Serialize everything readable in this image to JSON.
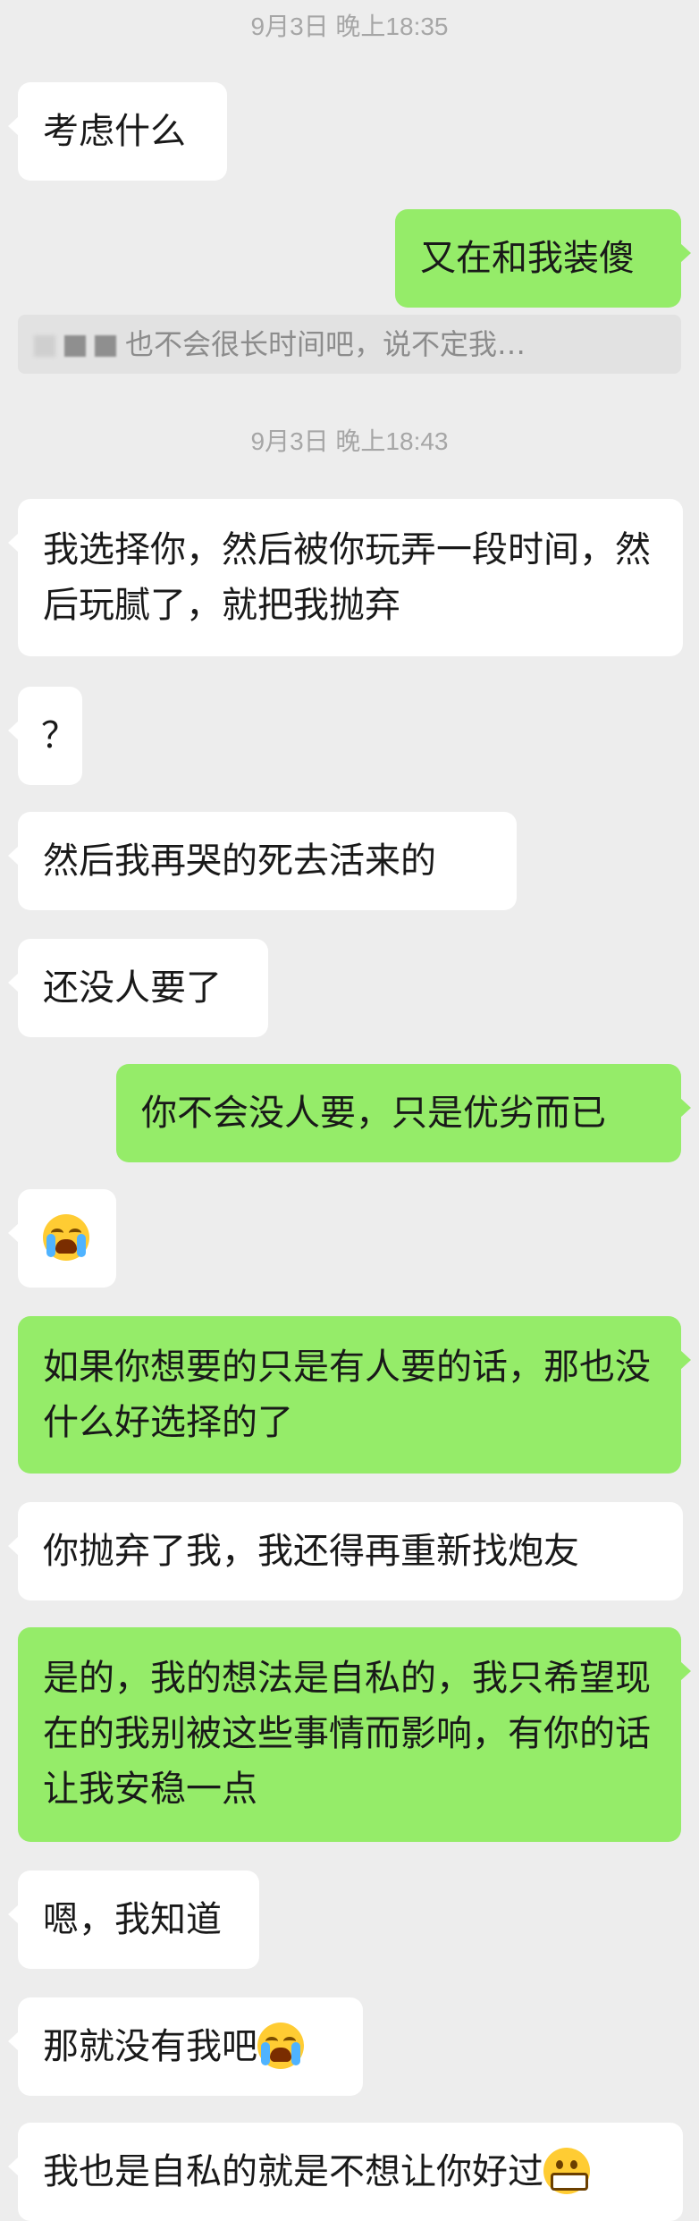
{
  "timestamps": [
    "9月3日 晚上18:35",
    "9月3日 晚上18:43"
  ],
  "quote": {
    "text": "也不会很长时间吧，说不定我…"
  },
  "messages": {
    "m1": "考虑什么",
    "m2": "又在和我装傻",
    "m3": "我选择你，然后被你玩弄一段时间，然后玩腻了，就把我抛弃",
    "m4": "？",
    "m5": "然后我再哭的死去活来的",
    "m6": "还没人要了",
    "m7": "你不会没人要，只是优劣而已",
    "m9": "如果你想要的只是有人要的话，那也没什么好选择的了",
    "m10": "你抛弃了我，我还得再重新找炮友",
    "m11": "是的，我的想法是自私的，我只希望现在的我别被这些事情而影响，有你的话让我安稳一点",
    "m12": "嗯，我知道",
    "m13": "那就没有我吧",
    "m14": "我也是自私的就是不想让你好过"
  },
  "icons": {
    "cry": "loudly-crying-face-emoji",
    "grin": "grimacing-face-emoji"
  },
  "colors": {
    "background": "#ededed",
    "incoming_bubble": "#ffffff",
    "outgoing_bubble": "#95ec69"
  }
}
